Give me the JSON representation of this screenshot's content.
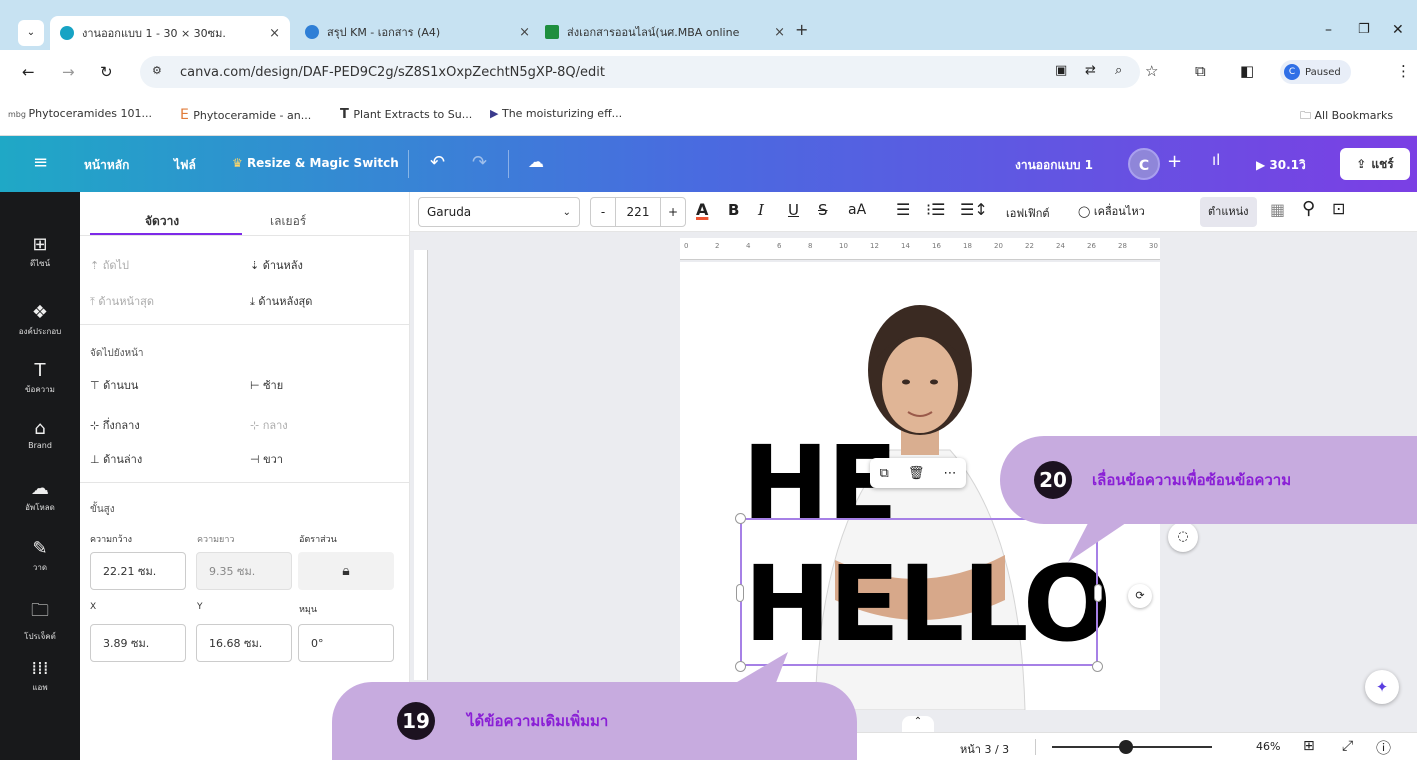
{
  "browser": {
    "tabs": [
      {
        "title": "งานออกแบบ 1 - 30 × 30ซม."
      },
      {
        "title": "สรุป KM - เอกสาร (A4)"
      },
      {
        "title": "ส่งเอกสารออนไลน์(นศ.MBA online"
      }
    ],
    "new_tab": "+",
    "url": "canva.com/design/DAF-PED9C2g/sZ8S1xOxpZechtN5gXP-8Q/edit",
    "profile_status": "Paused",
    "bookmarks": [
      "Phytoceramides 101...",
      "Phytoceramide - an...",
      "Plant Extracts to Su...",
      "The moisturizing eff..."
    ],
    "all_bookmarks": "All Bookmarks"
  },
  "header": {
    "home": "หน้าหลัก",
    "file": "ไฟล์",
    "resize": "Resize & Magic Switch",
    "design_title": "งานออกแบบ 1",
    "avatar": "C",
    "present_time": "30.1วิ",
    "share": "แชร์"
  },
  "rail": [
    {
      "label": "ดีไซน์",
      "icon": "template-icon"
    },
    {
      "label": "องค์ประกอบ",
      "icon": "elements-icon"
    },
    {
      "label": "ข้อความ",
      "icon": "text-icon"
    },
    {
      "label": "Brand",
      "icon": "brand-icon"
    },
    {
      "label": "อัพโหลด",
      "icon": "upload-icon"
    },
    {
      "label": "วาด",
      "icon": "draw-icon"
    },
    {
      "label": "โปรเจ็คต์",
      "icon": "folder-icon"
    },
    {
      "label": "แอพ",
      "icon": "apps-icon"
    }
  ],
  "panel": {
    "tab_arrange": "จัดวาง",
    "tab_layers": "เลเยอร์",
    "forward": "ถัดไป",
    "backward": "ด้านหลัง",
    "to_front": "ด้านหน้าสุด",
    "to_back": "ด้านหลังสุด",
    "align_section": "จัดไปยังหน้า",
    "top": "ด้านบน",
    "left": "ซ้าย",
    "middle": "กึ่งกลาง",
    "center": "กลาง",
    "bottom": "ด้านล่าง",
    "right": "ขวา",
    "advanced": "ขั้นสูง",
    "width_label": "ความกว้าง",
    "height_label": "ความยาว",
    "ratio_label": "อัตราส่วน",
    "width_value": "22.21 ซม.",
    "height_value": "9.35 ซม.",
    "x_label": "X",
    "y_label": "Y",
    "rotate_label": "หมุน",
    "x_value": "3.89 ซม.",
    "y_value": "16.68 ซม.",
    "rotate_value": "0°"
  },
  "toolbar": {
    "font": "Garuda",
    "size": "221",
    "minus": "-",
    "plus": "+",
    "case": "aA",
    "effects": "เอฟเฟิกต์",
    "animate": "เคลื่อนไหว",
    "position": "ตำแหน่ง"
  },
  "ruler": [
    "0",
    "2",
    "4",
    "6",
    "8",
    "10",
    "12",
    "14",
    "16",
    "18",
    "20",
    "22",
    "24",
    "26",
    "28",
    "30"
  ],
  "canvas": {
    "hello_top": "HE",
    "hello_main": "HELLO"
  },
  "bubbles": {
    "b20_num": "20",
    "b20_text": "เลื่อนข้อความเพื่อซ้อนข้อความ",
    "b19_num": "19",
    "b19_text": "ได้ข้อความเดิมเพิ่มมา"
  },
  "footer": {
    "page": "หน้า 3 / 3",
    "zoom": "46%",
    "zoom_fraction": 0.46
  }
}
